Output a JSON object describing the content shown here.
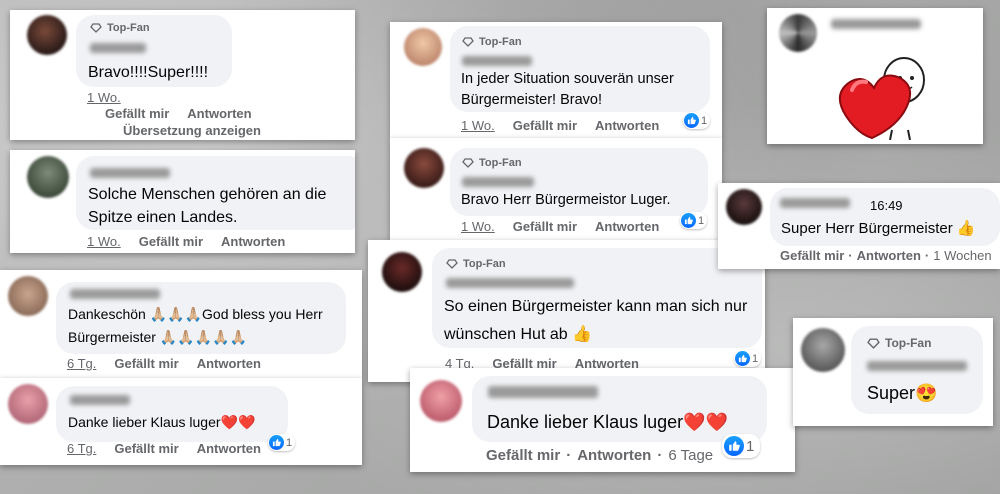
{
  "topfan_label": "Top-Fan",
  "colors": {
    "like": "#0866ff",
    "meta": "#65676b",
    "bubble": "#f0f2f5"
  },
  "comments": [
    {
      "text": "Bravo!!!!Super!!!!",
      "time": "1 Wo.",
      "like": "Gefällt mir",
      "reply": "Antworten",
      "translate": "Übersetzung anzeigen"
    },
    {
      "text": "Solche Menschen gehören an die Spitze einen Landes.",
      "time": "1 Wo.",
      "like": "Gefällt mir",
      "reply": "Antworten"
    },
    {
      "text": "Dankeschön 🙏🏼🙏🏼🙏🏼God bless you Herr Bürgermeister 🙏🏼🙏🏼🙏🏼🙏🏼🙏🏼",
      "time": "6 Tg.",
      "like": "Gefällt mir",
      "reply": "Antworten"
    },
    {
      "text": "Danke lieber Klaus luger❤️❤️",
      "time": "6 Tg.",
      "like": "Gefällt mir",
      "reply": "Antworten",
      "reactions": "1"
    },
    {
      "text": "In jeder Situation souverän unser Bürgermeister! Bravo!",
      "time": "1 Wo.",
      "like": "Gefällt mir",
      "reply": "Antworten",
      "reactions": "1"
    },
    {
      "text": "Bravo Herr Bürgermeistor Luger.",
      "time": "1 Wo.",
      "like": "Gefällt mir",
      "reply": "Antworten",
      "reactions": "1"
    },
    {
      "text": "So einen Bürgermeister kann man sich nur wünschen Hut ab 👍",
      "time": "4 Tg.",
      "like": "Gefällt mir",
      "reply": "Antworten",
      "reactions": "1"
    },
    {
      "text": "Danke lieber Klaus luger❤️❤️",
      "time": "6 Tage",
      "like": "Gefällt mir",
      "reply": "Antworten",
      "reactions": "1"
    },
    {
      "text": "Super Herr Bürgermeister 👍",
      "header_time": "16:49",
      "time": "1 Wochen",
      "like": "Gefällt mir",
      "reply": "Antworten"
    },
    {
      "text": "Super😍"
    }
  ]
}
